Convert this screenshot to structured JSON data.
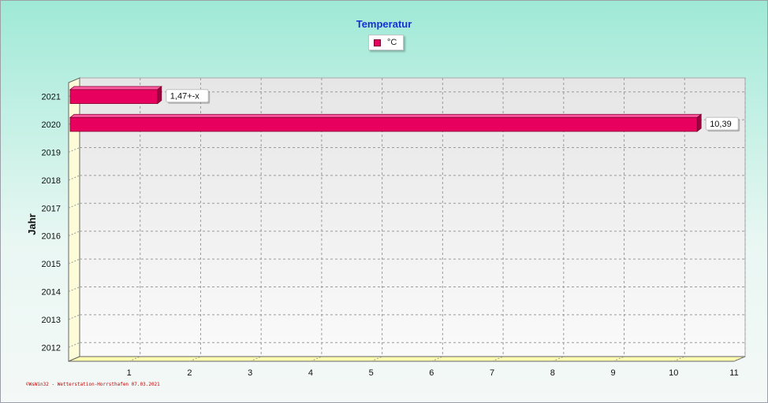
{
  "chart_data": {
    "type": "bar",
    "orientation": "horizontal",
    "title": "Temperatur",
    "ylabel": "Jahr",
    "categories": [
      "2012",
      "2013",
      "2014",
      "2015",
      "2016",
      "2017",
      "2018",
      "2019",
      "2020",
      "2021"
    ],
    "series": [
      {
        "name": "°C",
        "values": [
          null,
          null,
          null,
          null,
          null,
          null,
          null,
          null,
          10.39,
          1.47
        ],
        "labels": [
          "",
          "",
          "",
          "",
          "",
          "",
          "",
          "",
          "10,39",
          "1,47+-x"
        ]
      }
    ],
    "x_ticks": [
      1,
      2,
      3,
      4,
      5,
      6,
      7,
      8,
      9,
      10,
      11
    ],
    "xlim": [
      0,
      11
    ],
    "grid": true,
    "legend_position": "top-center",
    "bar_color": "#e8005f"
  },
  "footer": {
    "credit": "©WsWin32 - Wetterstation-Horrsthafen 07.03.2021"
  }
}
